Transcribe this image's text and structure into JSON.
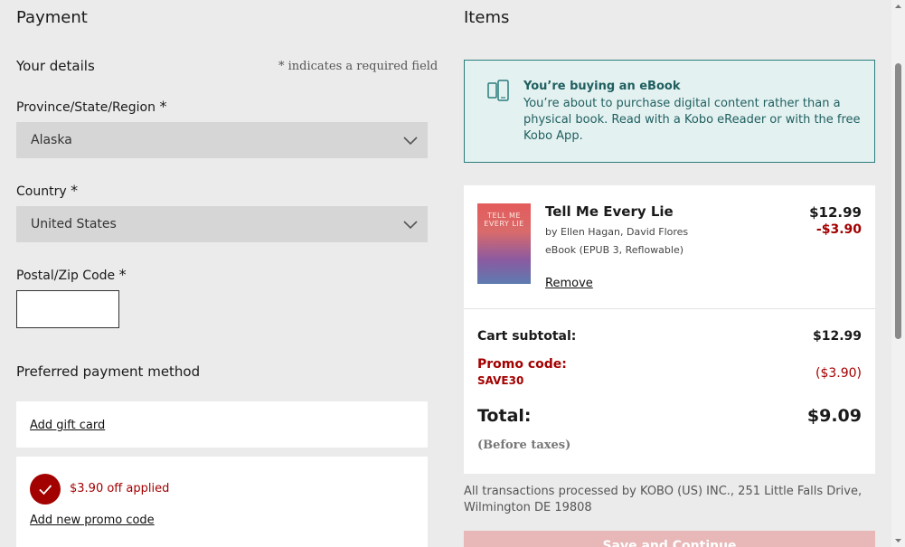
{
  "left": {
    "title": "Payment",
    "your_details": "Your details",
    "required_note": "* indicates a required field",
    "province_label": "Province/State/Region",
    "province_value": "Alaska",
    "country_label": "Country",
    "country_value": "United States",
    "postal_label": "Postal/Zip Code",
    "postal_value": "",
    "payment_method": "Preferred payment method",
    "add_gift_card": "Add gift card",
    "promo_applied": "$3.90 off applied",
    "add_promo": "Add new promo code",
    "required_star": "*"
  },
  "right": {
    "title": "Items",
    "notice_title": "You’re buying an eBook",
    "notice_body": "You’re about to purchase digital content rather than a physical book. Read with a Kobo eReader or with the free Kobo App.",
    "book": {
      "title": "Tell Me Every Lie",
      "authors": "by Ellen Hagan, David Flores",
      "format": "eBook (EPUB 3, Reflowable)",
      "price": "$12.99",
      "discount": "-$3.90",
      "remove": "Remove",
      "cover_text": "TELL ME EVERY LIE"
    },
    "summary": {
      "subtotal_label": "Cart subtotal:",
      "subtotal_value": "$12.99",
      "promo_label": "Promo code:",
      "promo_code": "SAVE30",
      "promo_value": "($3.90)",
      "total_label": "Total:",
      "total_value": "$9.09",
      "before_taxes": "(Before taxes)"
    },
    "footer_text": "All transactions processed by KOBO (US) INC., 251 Little Falls Drive, Wilmington DE 19808",
    "save_button": "Save and Continue"
  },
  "colors": {
    "accent_red": "#a30000",
    "notice_border": "#2c7c7c",
    "notice_bg": "#e4f1f1",
    "button_disabled": "#e8b8b8"
  }
}
